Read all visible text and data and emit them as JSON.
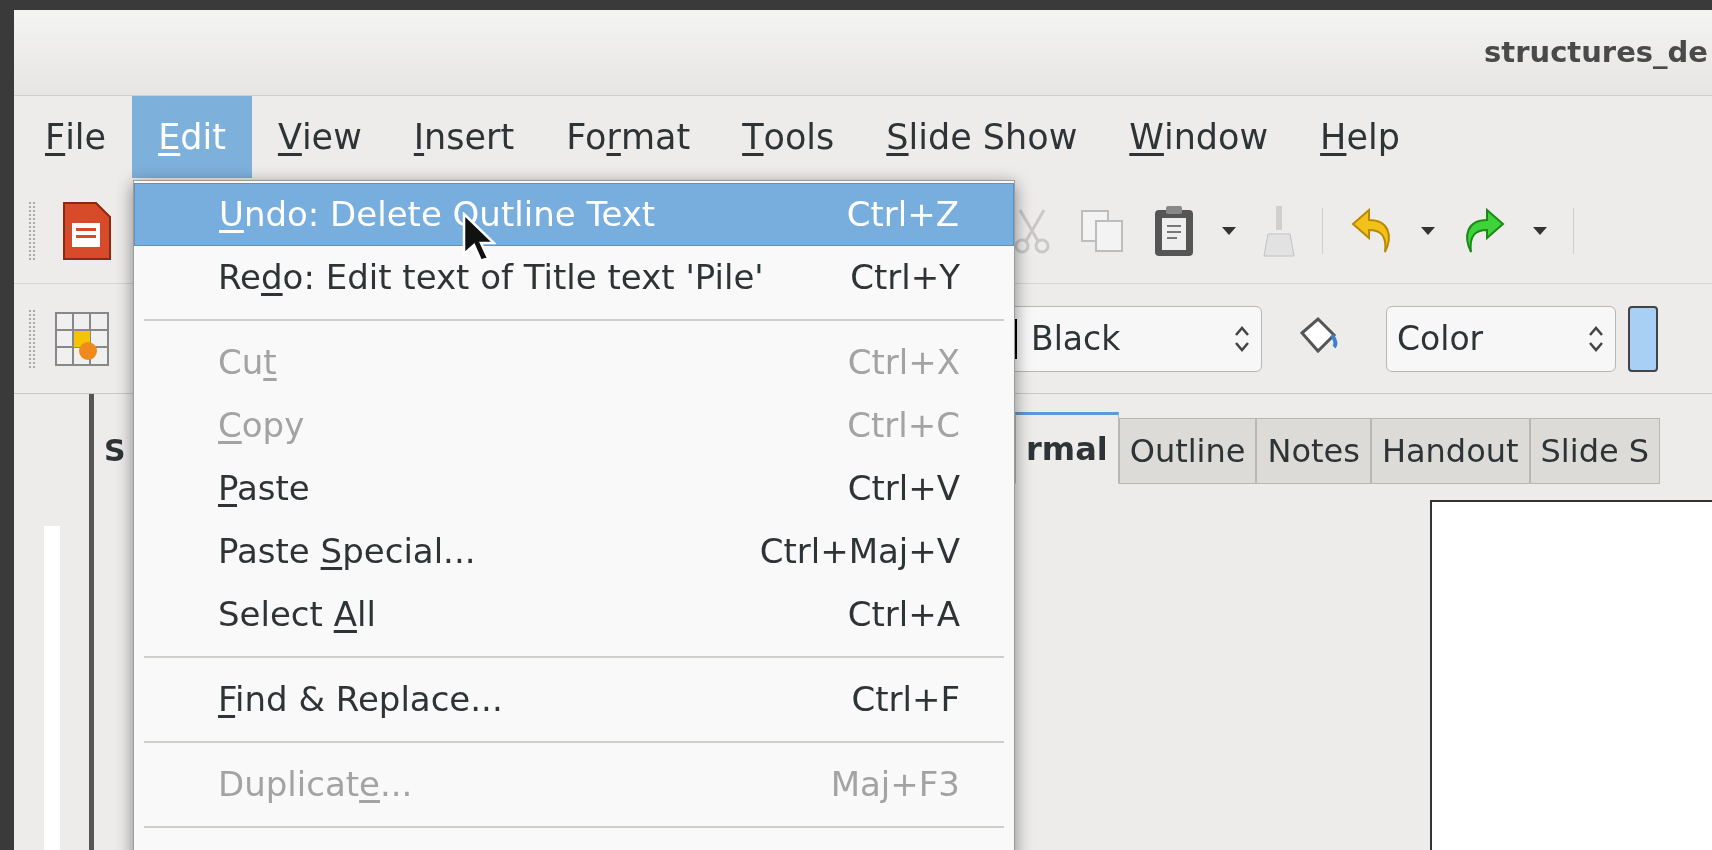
{
  "window": {
    "title": "structures_de"
  },
  "menubar": [
    {
      "parts": {
        "key": "F",
        "post": "ile"
      },
      "selected": false
    },
    {
      "parts": {
        "key": "E",
        "post": "dit"
      },
      "selected": true
    },
    {
      "parts": {
        "key": "V",
        "post": "iew"
      },
      "selected": false
    },
    {
      "parts": {
        "key": "I",
        "post": "nsert"
      },
      "selected": false
    },
    {
      "parts": {
        "pre": "Fo",
        "key": "r",
        "post": "mat"
      },
      "selected": false
    },
    {
      "parts": {
        "key": "T",
        "post": "ools"
      },
      "selected": false
    },
    {
      "parts": {
        "key": "S",
        "post": "lide Show"
      },
      "selected": false
    },
    {
      "parts": {
        "key": "W",
        "post": "indow"
      },
      "selected": false
    },
    {
      "parts": {
        "key": "H",
        "post": "elp"
      },
      "selected": false
    }
  ],
  "format_bar": {
    "line_color": "Black",
    "area_style": "Color"
  },
  "slides_pane": {
    "title": "S"
  },
  "view_tabs": [
    {
      "label": "rmal",
      "selected": true
    },
    {
      "label": "Outline",
      "selected": false
    },
    {
      "label": "Notes",
      "selected": false
    },
    {
      "label": "Handout",
      "selected": false
    },
    {
      "label": "Slide S",
      "selected": false
    }
  ],
  "edit_menu": [
    {
      "kind": "item",
      "parts": {
        "key": "U",
        "post": "ndo: Delete Outline Text"
      },
      "shortcut": "Ctrl+Z",
      "selected": true,
      "disabled": false
    },
    {
      "kind": "item",
      "parts": {
        "pre": "Re",
        "key": "d",
        "post": "o: Edit text of Title text 'Pile'"
      },
      "shortcut": "Ctrl+Y",
      "selected": false,
      "disabled": false
    },
    {
      "kind": "separator"
    },
    {
      "kind": "item",
      "parts": {
        "pre": "Cu",
        "key": "t"
      },
      "shortcut": "Ctrl+X",
      "selected": false,
      "disabled": true
    },
    {
      "kind": "item",
      "parts": {
        "key": "C",
        "post": "opy"
      },
      "shortcut": "Ctrl+C",
      "selected": false,
      "disabled": true
    },
    {
      "kind": "item",
      "parts": {
        "key": "P",
        "post": "aste"
      },
      "shortcut": "Ctrl+V",
      "selected": false,
      "disabled": false
    },
    {
      "kind": "item",
      "parts": {
        "pre": "Paste ",
        "key": "S",
        "post": "pecial..."
      },
      "shortcut": "Ctrl+Maj+V",
      "selected": false,
      "disabled": false
    },
    {
      "kind": "item",
      "parts": {
        "pre": "Select ",
        "key": "A",
        "post": "ll"
      },
      "shortcut": "Ctrl+A",
      "selected": false,
      "disabled": false
    },
    {
      "kind": "separator"
    },
    {
      "kind": "item",
      "parts": {
        "key": "F",
        "post": "ind & Replace..."
      },
      "shortcut": "Ctrl+F",
      "selected": false,
      "disabled": false
    },
    {
      "kind": "separator"
    },
    {
      "kind": "item",
      "parts": {
        "pre": "Duplicat",
        "key": "e",
        "post": "..."
      },
      "shortcut": "Maj+F3",
      "selected": false,
      "disabled": true
    },
    {
      "kind": "separator"
    }
  ]
}
